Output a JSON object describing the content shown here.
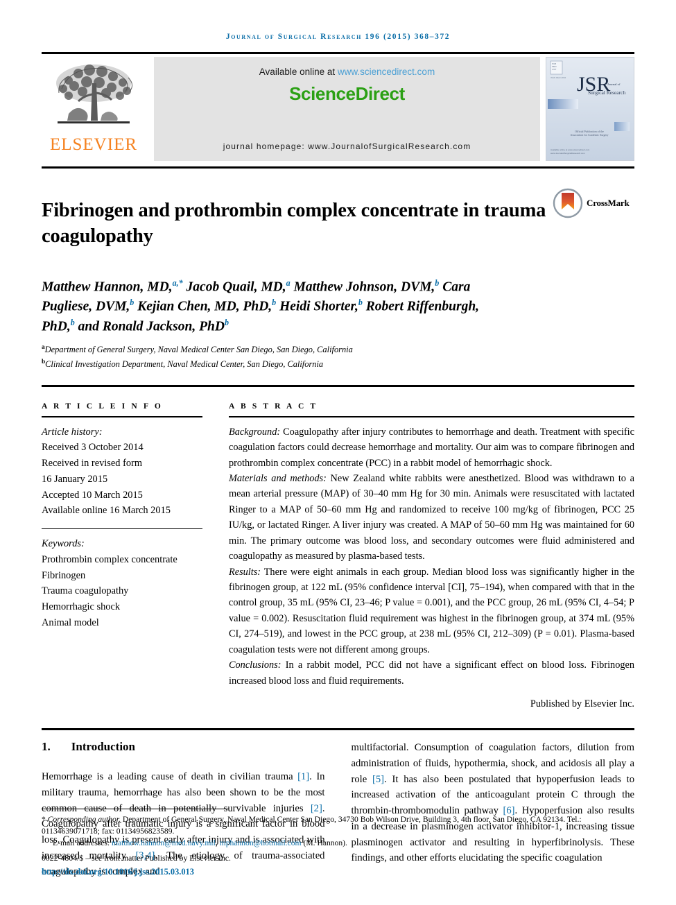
{
  "running_head": "Journal of Surgical Research 196 (2015) 368–372",
  "masthead": {
    "publisher_name": "ELSEVIER",
    "available_text": "Available online at ",
    "sciencedirect_url": "www.sciencedirect.com",
    "brand": "ScienceDirect",
    "homepage": "journal homepage: www.JournalofSurgicalResearch.com",
    "cover": {
      "title_abbr": "JSR",
      "title_small_1": "Journal of",
      "title_small_2": "Surgical Research",
      "tagline_1": "Official Publication of the",
      "tagline_2": "Association for Academic Surgery",
      "imprint": "Available online at www.sciencedirect.com",
      "imprint2": "www.JournalofSurgicalResearch.com"
    }
  },
  "article": {
    "title": "Fibrinogen and prothrombin complex concentrate in trauma coagulopathy",
    "crossmark_label": "CrossMark",
    "authors_html": "Matthew Hannon, MD,<sup>a,*</sup> Jacob Quail, MD,<sup>a</sup> Matthew Johnson, DVM,<sup>b</sup> Cara Pugliese, DVM,<sup>b</sup> Kejian Chen, MD, PhD,<sup>b</sup> Heidi Shorter,<sup>b</sup> Robert Riffenburgh, PhD,<sup>b</sup> and Ronald Jackson, PhD<sup>b</sup>",
    "affiliations": [
      {
        "marker": "a",
        "text": "Department of General Surgery, Naval Medical Center San Diego, San Diego, California"
      },
      {
        "marker": "b",
        "text": "Clinical Investigation Department, Naval Medical Center, San Diego, California"
      }
    ]
  },
  "article_info": {
    "heading": "A R T I C L E  I N F O",
    "history_label": "Article history:",
    "history": [
      "Received 3 October 2014",
      "Received in revised form",
      "16 January 2015",
      "Accepted 10 March 2015",
      "Available online 16 March 2015"
    ],
    "keywords_label": "Keywords:",
    "keywords": [
      "Prothrombin complex concentrate",
      "Fibrinogen",
      "Trauma coagulopathy",
      "Hemorrhagic shock",
      "Animal model"
    ]
  },
  "abstract": {
    "heading": "A B S T R A C T",
    "sections": [
      {
        "lead": "Background:",
        "text": " Coagulopathy after injury contributes to hemorrhage and death. Treatment with specific coagulation factors could decrease hemorrhage and mortality. Our aim was to compare fibrinogen and prothrombin complex concentrate (PCC) in a rabbit model of hemorrhagic shock."
      },
      {
        "lead": "Materials and methods:",
        "text": " New Zealand white rabbits were anesthetized. Blood was withdrawn to a mean arterial pressure (MAP) of 30–40 mm Hg for 30 min. Animals were resuscitated with lactated Ringer to a MAP of 50–60 mm Hg and randomized to receive 100 mg/kg of fibrinogen, PCC 25 IU/kg, or lactated Ringer. A liver injury was created. A MAP of 50–60 mm Hg was maintained for 60 min. The primary outcome was blood loss, and secondary outcomes were fluid administered and coagulopathy as measured by plasma-based tests."
      },
      {
        "lead": "Results:",
        "text": " There were eight animals in each group. Median blood loss was significantly higher in the fibrinogen group, at 122 mL (95% confidence interval [CI], 75–194), when compared with that in the control group, 35 mL (95% CI, 23–46; P value = 0.001), and the PCC group, 26 mL (95% CI, 4–54; P value = 0.002). Resuscitation fluid requirement was highest in the fibrinogen group, at 374 mL (95% CI, 274–519), and lowest in the PCC group, at 238 mL (95% CI, 212–309) (P = 0.01). Plasma-based coagulation tests were not different among groups."
      },
      {
        "lead": "Conclusions:",
        "text": " In a rabbit model, PCC did not have a significant effect on blood loss. Fibrinogen increased blood loss and fluid requirements."
      }
    ],
    "published_by": "Published by Elsevier Inc."
  },
  "body": {
    "section_number": "1.",
    "section_title": "Introduction",
    "left_column_html": "Hemorrhage is a leading cause of death in civilian trauma <span class=\"ref\">[1]</span>. In military trauma, hemorrhage has also been shown to be the most common cause of death in potentially survivable injuries <span class=\"ref\">[2]</span>. Coagulopathy after traumatic injury is a significant factor in blood loss. Coagulopathy is present early after injury and is associated with increased mortality <span class=\"ref\">[3,4]</span>. The etiology of trauma-associated coagulopathy is complex and",
    "right_column_html": "multifactorial. Consumption of coagulation factors, dilution from administration of fluids, hypothermia, shock, and acidosis all play a role <span class=\"ref\">[5]</span>. It has also been postulated that hypoperfusion leads to increased activation of the anticoagulant protein C through the thrombin-thrombomodulin pathway <span class=\"ref\">[6]</span>. Hypoperfusion also results in a decrease in plasminogen activator inhibitor-1, increasing tissue plasminogen activator and resulting in hyperfibrinolysis. These findings, and other efforts elucidating the specific coagulation"
  },
  "footer": {
    "corresponding_marker": "*",
    "corresponding_label": "Corresponding author.",
    "corresponding_text": " Department of General Surgery, Naval Medical Center San Diego, 34730 Bob Wilson Drive, Building 3, 4th floor, San Diego, CA 92134. Tel.: 01134639071718; fax: 01134956823589.",
    "email_label": "E-mail addresses: ",
    "email_1": "matthew.hannon@med.navy.mil",
    "email_2": "mphannon@hotmail.com",
    "email_suffix": " (M. Hannon).",
    "issn_line": "0022-4804/$ – see front matter Published by Elsevier Inc.",
    "doi": "http://dx.doi.org/10.1016/j.jss.2015.03.013"
  },
  "colors": {
    "accent_blue": "#0b6ea8",
    "link_blue": "#4a9fd4",
    "sciencedirect_green": "#2ba014",
    "elsevier_orange": "#f58220",
    "panel_gray": "#e3e3e3"
  }
}
